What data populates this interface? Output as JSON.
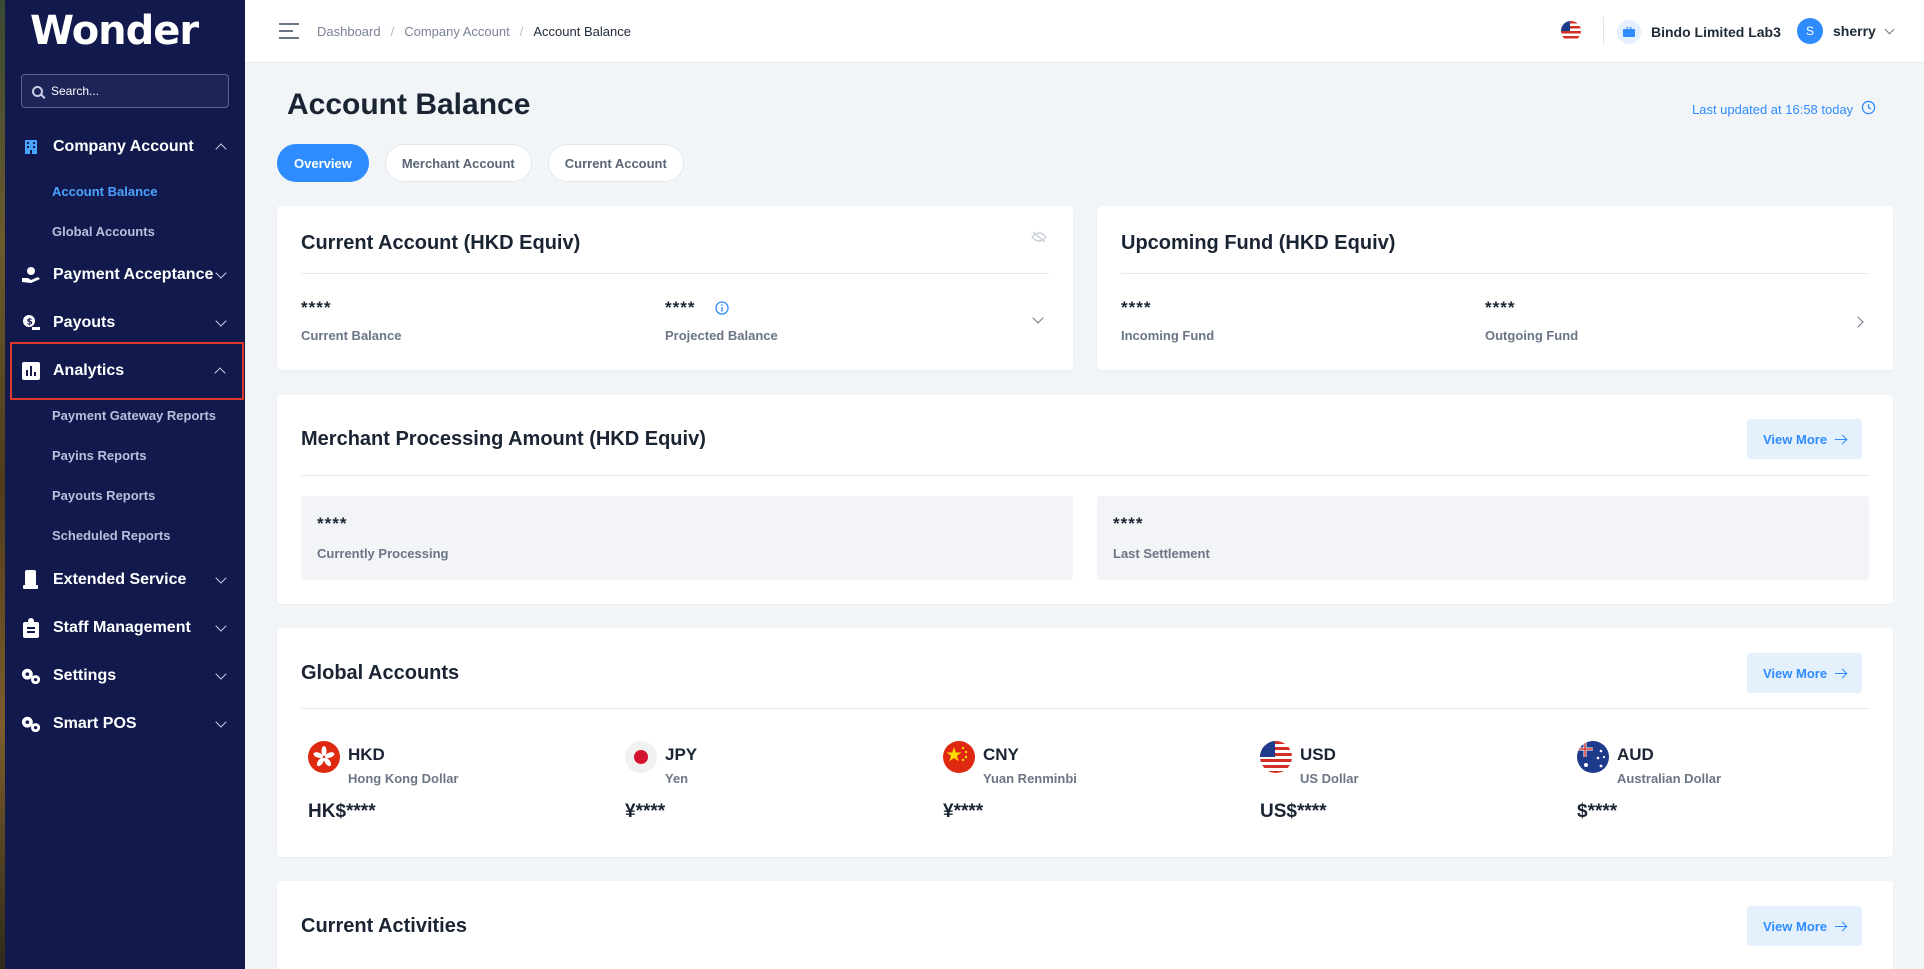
{
  "app": {
    "name": "Wonder"
  },
  "sidebar": {
    "search_placeholder": "Search...",
    "groups": [
      {
        "label": "Company Account",
        "icon": "building-icon",
        "expanded": true,
        "items": [
          {
            "label": "Account Balance",
            "active": true
          },
          {
            "label": "Global Accounts"
          }
        ]
      },
      {
        "label": "Payment Acceptance",
        "icon": "hand-payment-icon",
        "expanded": false
      },
      {
        "label": "Payouts",
        "icon": "payout-icon",
        "expanded": false
      },
      {
        "label": "Analytics",
        "icon": "chart-icon",
        "expanded": true,
        "highlighted": true,
        "items": [
          {
            "label": "Payment Gateway Reports"
          },
          {
            "label": "Payins Reports"
          },
          {
            "label": "Payouts Reports"
          },
          {
            "label": "Scheduled Reports"
          }
        ]
      },
      {
        "label": "Extended Service",
        "icon": "device-icon",
        "expanded": false
      },
      {
        "label": "Staff Management",
        "icon": "staff-icon",
        "expanded": false
      },
      {
        "label": "Settings",
        "icon": "gears-icon",
        "expanded": false
      },
      {
        "label": "Smart POS",
        "icon": "gears-icon",
        "expanded": false
      }
    ]
  },
  "topbar": {
    "breadcrumb": [
      "Dashboard",
      "Company Account",
      "Account Balance"
    ],
    "breadcrumb_sep": "/",
    "company_name": "Bindo Limited Lab3",
    "user_initial": "S",
    "user_name": "sherry"
  },
  "page": {
    "title": "Account Balance",
    "last_updated": "Last updated at 16:58 today",
    "tabs": [
      {
        "label": "Overview",
        "active": true
      },
      {
        "label": "Merchant Account"
      },
      {
        "label": "Current Account"
      }
    ]
  },
  "current_account": {
    "title": "Current Account (HKD Equiv)",
    "current_balance_value": "****",
    "current_balance_label": "Current Balance",
    "projected_balance_value": "****",
    "projected_balance_label": "Projected Balance"
  },
  "upcoming_fund": {
    "title": "Upcoming Fund (HKD Equiv)",
    "incoming_value": "****",
    "incoming_label": "Incoming Fund",
    "outgoing_value": "****",
    "outgoing_label": "Outgoing Fund"
  },
  "merchant_processing": {
    "title": "Merchant Processing Amount (HKD Equiv)",
    "view_more": "View More",
    "processing_value": "****",
    "processing_label": "Currently Processing",
    "settlement_value": "****",
    "settlement_label": "Last Settlement"
  },
  "global_accounts": {
    "title": "Global Accounts",
    "view_more": "View More",
    "currencies": [
      {
        "code": "HKD",
        "name": "Hong Kong Dollar",
        "amount": "HK$****",
        "flag": "hk-flag-icon"
      },
      {
        "code": "JPY",
        "name": "Yen",
        "amount": "¥****",
        "flag": "jp-flag-icon"
      },
      {
        "code": "CNY",
        "name": "Yuan Renminbi",
        "amount": "¥****",
        "flag": "cn-flag-icon"
      },
      {
        "code": "USD",
        "name": "US Dollar",
        "amount": "US$****",
        "flag": "us-flag-icon"
      },
      {
        "code": "AUD",
        "name": "Australian Dollar",
        "amount": "$****",
        "flag": "au-flag-icon"
      }
    ]
  },
  "current_activities": {
    "title": "Current Activities",
    "view_more": "View More"
  },
  "colors": {
    "sidebar": "#121a4d",
    "accent": "#2f8cff",
    "highlight_border": "#e0392b",
    "background": "#f2f5f8"
  }
}
